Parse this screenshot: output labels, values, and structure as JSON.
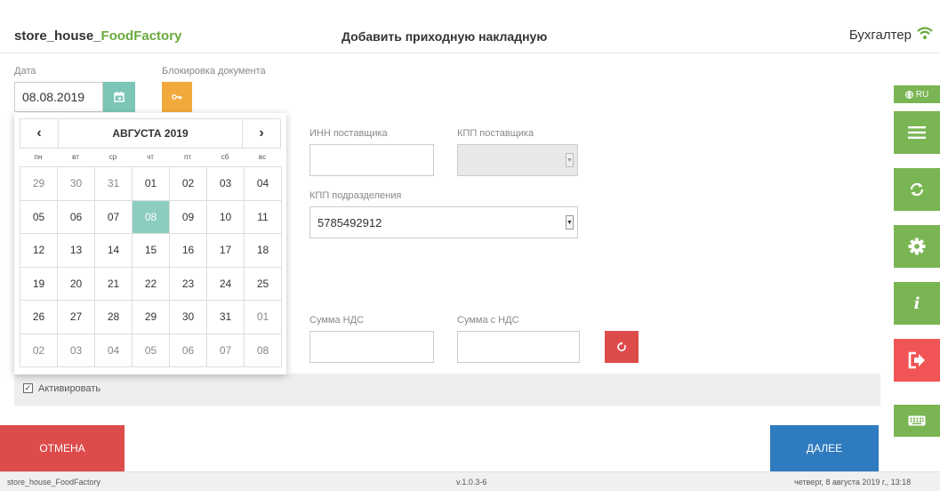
{
  "header": {
    "app_name_prefix": "store_house_",
    "app_name_suffix": "FoodFactory",
    "title": "Добавить приходную накладную",
    "user_role": "Бухгалтер"
  },
  "form": {
    "date_label": "Дата",
    "date_value": "08.08.2019",
    "lock_label": "Блокировка документа",
    "inn_label": "ИНН поставщика",
    "inn_value": "",
    "kpp_supplier_label": "КПП поставщика",
    "kpp_division_label": "КПП подразделения",
    "kpp_division_value": "5785492912",
    "vat_sum_label": "Сумма НДС",
    "vat_sum_value": "",
    "sum_with_vat_label": "Сумма с НДС",
    "sum_with_vat_value": "",
    "activate_label": "Активировать",
    "activate_checked": true
  },
  "calendar": {
    "prev": "‹",
    "next": "›",
    "month_label": "АВГУСТА 2019",
    "weekdays": [
      "пн",
      "вт",
      "ср",
      "чт",
      "пт",
      "сб",
      "вс"
    ],
    "selected": "08",
    "weeks": [
      [
        {
          "d": "29",
          "o": true
        },
        {
          "d": "30",
          "o": true
        },
        {
          "d": "31",
          "o": true
        },
        {
          "d": "01"
        },
        {
          "d": "02"
        },
        {
          "d": "03"
        },
        {
          "d": "04"
        }
      ],
      [
        {
          "d": "05"
        },
        {
          "d": "06"
        },
        {
          "d": "07"
        },
        {
          "d": "08",
          "s": true
        },
        {
          "d": "09"
        },
        {
          "d": "10"
        },
        {
          "d": "11"
        }
      ],
      [
        {
          "d": "12"
        },
        {
          "d": "13"
        },
        {
          "d": "14"
        },
        {
          "d": "15"
        },
        {
          "d": "16"
        },
        {
          "d": "17"
        },
        {
          "d": "18"
        }
      ],
      [
        {
          "d": "19"
        },
        {
          "d": "20"
        },
        {
          "d": "21"
        },
        {
          "d": "22"
        },
        {
          "d": "23"
        },
        {
          "d": "24"
        },
        {
          "d": "25"
        }
      ],
      [
        {
          "d": "26"
        },
        {
          "d": "27"
        },
        {
          "d": "28"
        },
        {
          "d": "29"
        },
        {
          "d": "30"
        },
        {
          "d": "31"
        },
        {
          "d": "01",
          "o": true
        }
      ],
      [
        {
          "d": "02",
          "o": true
        },
        {
          "d": "03",
          "o": true
        },
        {
          "d": "04",
          "o": true
        },
        {
          "d": "05",
          "o": true
        },
        {
          "d": "06",
          "o": true
        },
        {
          "d": "07",
          "o": true
        },
        {
          "d": "08",
          "o": true
        }
      ]
    ]
  },
  "buttons": {
    "cancel": "ОТМЕНА",
    "next": "ДАЛЕЕ"
  },
  "sidebar": {
    "lang": "RU",
    "items": [
      "menu-icon",
      "sync-icon",
      "settings-icon",
      "info-icon",
      "logout-icon",
      "keyboard-icon"
    ]
  },
  "footer": {
    "app": "store_house_FoodFactory",
    "version": "v.1.0.3-6",
    "datetime": "четверг, 8 августа 2019 г., 13:18"
  },
  "colors": {
    "brand_green": "#7ab554",
    "danger": "#dd4b4b",
    "primary": "#2f7bbf",
    "calendar_selected": "#8ccdbf",
    "lock_orange": "#f2a93b"
  }
}
